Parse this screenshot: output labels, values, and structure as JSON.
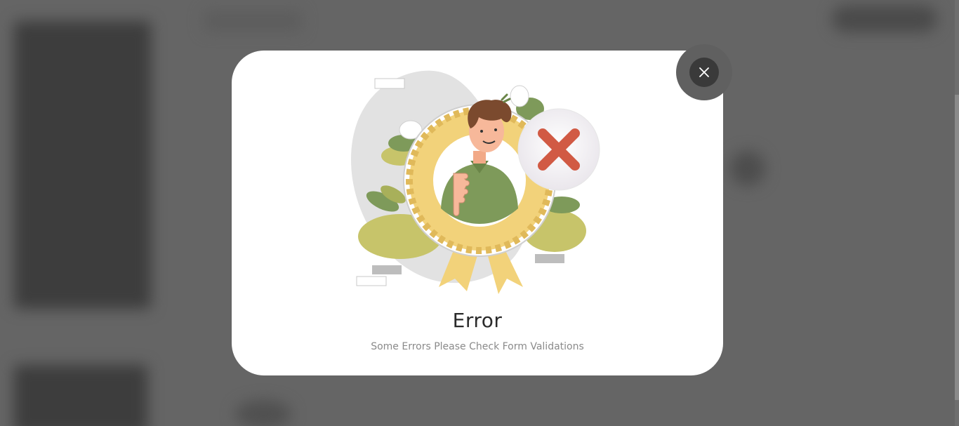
{
  "dialog": {
    "title": "Error",
    "message": "Some Errors Please Check Form Validations",
    "close_icon": "close-icon",
    "illustration_icon": "thumbs-down-badge-illustration",
    "error_icon": "red-x-icon"
  },
  "colors": {
    "overlay": "#656565",
    "dialog_bg": "#ffffff",
    "close_button_bg": "#3a3a3a",
    "error_red": "#d15a44",
    "badge_gold": "#f2d27a",
    "leaf_green": "#7e9a5a"
  }
}
